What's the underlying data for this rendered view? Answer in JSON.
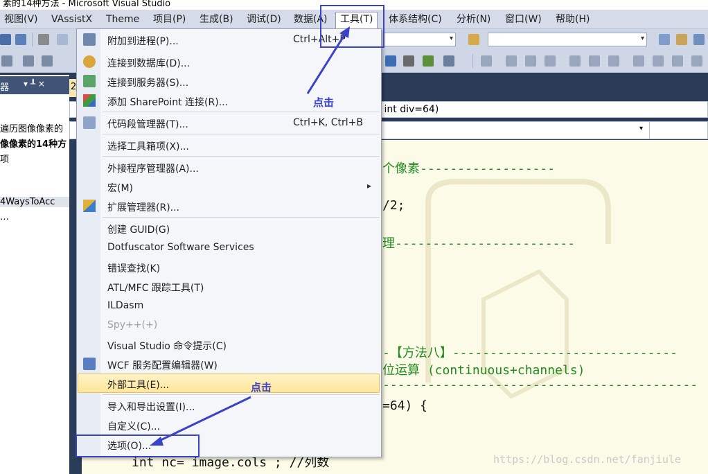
{
  "window": {
    "title": "素的14种方法 - Microsoft Visual Studio"
  },
  "menubar": {
    "items": [
      {
        "label": "视图(V)"
      },
      {
        "label": "VAssistX"
      },
      {
        "label": "Theme"
      },
      {
        "label": "项目(P)"
      },
      {
        "label": "生成(B)"
      },
      {
        "label": "调试(D)"
      },
      {
        "label": "数据(A)"
      },
      {
        "label": "工具(T)"
      },
      {
        "label": "体系结构(C)"
      },
      {
        "label": "分析(N)"
      },
      {
        "label": "窗口(W)"
      },
      {
        "label": "帮助(H)"
      }
    ]
  },
  "left_panel": {
    "header": "器",
    "pin": "▾ ╨ ×",
    "lines": [
      "遍历图像像素的",
      "像像素的14种方",
      "项",
      "4WaysToAcc",
      "…"
    ]
  },
  "editor": {
    "tab_label": "2",
    "signature": "e, int div=64)",
    "code_lines": [
      "个像素------------------",
      "/2;",
      "理------------------------",
      "-【方法八】------------------------------",
      "位运算 (continuous+channels)",
      "=64) {",
      "int nc= image.cols ; //列数"
    ]
  },
  "tools_menu": {
    "items": [
      {
        "label": "附加到进程(P)...",
        "shortcut": "Ctrl+Alt+P"
      },
      {
        "label": "连接到数据库(D)..."
      },
      {
        "label": "连接到服务器(S)..."
      },
      {
        "label": "添加 SharePoint 连接(R)..."
      },
      {
        "label": "代码段管理器(T)...",
        "shortcut": "Ctrl+K, Ctrl+B"
      },
      {
        "label": "选择工具箱项(X)..."
      },
      {
        "label": "外接程序管理器(A)..."
      },
      {
        "label": "宏(M)",
        "submenu": "▸"
      },
      {
        "label": "扩展管理器(R)..."
      },
      {
        "label": "创建 GUID(G)"
      },
      {
        "label": "Dotfuscator Software Services"
      },
      {
        "label": "错误查找(K)"
      },
      {
        "label": "ATL/MFC 跟踪工具(T)"
      },
      {
        "label": "ILDasm"
      },
      {
        "label": "Spy++(+)"
      },
      {
        "label": "Visual Studio 命令提示(C)"
      },
      {
        "label": "WCF 服务配置编辑器(W)"
      },
      {
        "label": "外部工具(E)..."
      },
      {
        "label": "导入和导出设置(I)..."
      },
      {
        "label": "自定义(C)..."
      },
      {
        "label": "选项(O)..."
      }
    ]
  },
  "annotations": {
    "click_note_1": "点击",
    "click_note_2": "点击",
    "color": "#3a42c8"
  },
  "watermark": "https://blog.csdn.net/fanjiule"
}
